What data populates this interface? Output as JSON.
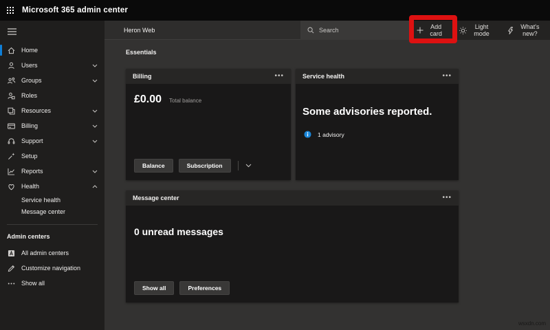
{
  "topbar": {
    "title": "Microsoft 365 admin center"
  },
  "sidebar": {
    "items": [
      {
        "label": "Home",
        "icon": "home",
        "chevron": "",
        "active": true
      },
      {
        "label": "Users",
        "icon": "users",
        "chevron": "down"
      },
      {
        "label": "Groups",
        "icon": "groups",
        "chevron": "down"
      },
      {
        "label": "Roles",
        "icon": "roles",
        "chevron": ""
      },
      {
        "label": "Resources",
        "icon": "resources",
        "chevron": "down"
      },
      {
        "label": "Billing",
        "icon": "billing",
        "chevron": "down"
      },
      {
        "label": "Support",
        "icon": "support",
        "chevron": "down"
      },
      {
        "label": "Setup",
        "icon": "setup",
        "chevron": ""
      },
      {
        "label": "Reports",
        "icon": "reports",
        "chevron": "down"
      },
      {
        "label": "Health",
        "icon": "health",
        "chevron": "up"
      },
      {
        "label": "Service health",
        "sub": true
      },
      {
        "label": "Message center",
        "sub": true
      }
    ],
    "section_heading": "Admin centers",
    "footer_items": [
      {
        "label": "All admin centers",
        "icon": "admin-centers"
      },
      {
        "label": "Customize navigation",
        "icon": "pencil"
      },
      {
        "label": "Show all",
        "icon": "ellipsis"
      }
    ]
  },
  "toolbar": {
    "tenant_name": "Heron Web",
    "search_label": "Search",
    "add_card_label": "Add card",
    "light_mode_label": "Light mode",
    "whats_new_label": "What's new?"
  },
  "annotation": {
    "color": "#dd1111",
    "target": "add-card-button"
  },
  "main": {
    "section_title": "Essentials",
    "cards": {
      "billing": {
        "title": "Billing",
        "amount": "£0.00",
        "amount_caption": "Total balance",
        "buttons": [
          "Balance",
          "Subscription"
        ]
      },
      "service_health": {
        "title": "Service health",
        "headline": "Some advisories reported.",
        "advisory": "1 advisory",
        "info_color": "#1a86d9"
      },
      "message_center": {
        "title": "Message center",
        "headline": "0 unread messages",
        "buttons": [
          "Show all",
          "Preferences"
        ]
      }
    }
  },
  "watermark": "wsxdn.com",
  "colors": {
    "accent_blue": "#0f7fd7",
    "annotation_red": "#dd1111",
    "topbar_bg": "#0a0a0a",
    "sidebar_bg": "#1f1e1d",
    "main_bg": "#333231",
    "card_bg": "#191818"
  }
}
